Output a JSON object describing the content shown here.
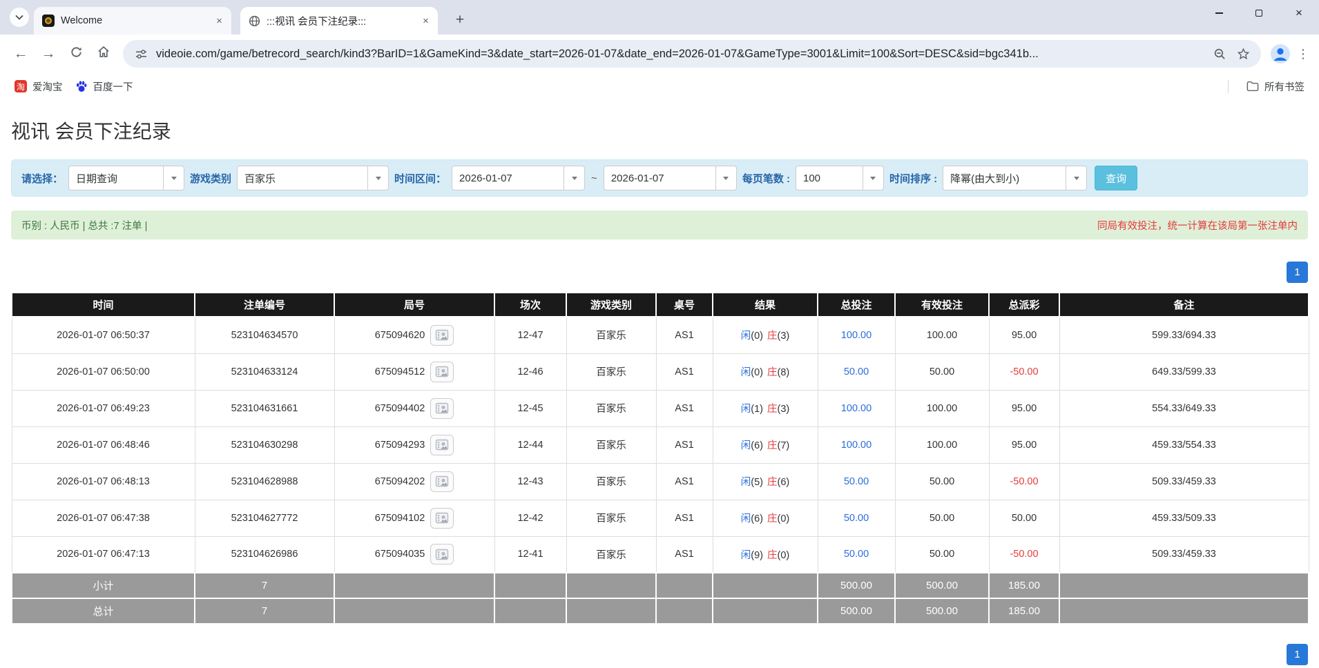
{
  "colors": {
    "pagination-blue": "#2878d8",
    "link-blue": "#2a6edb",
    "result-red": "#e43b3b",
    "filter-panel-blue": "#d9edf7",
    "summary-bar-green": "#dff0d8",
    "search-button-blue": "#5bc0de",
    "table-header-dark": "#1a1a1a"
  },
  "icons": {
    "close-icon": "×",
    "new-tab-icon": "+",
    "back-icon": "←",
    "forward-icon": "→",
    "menu-icon": "⋮",
    "taobao-icon": "淘",
    "minimize-icon": "–",
    "maximize-icon": "□",
    "reload-icon": "circular-arrow",
    "home-icon": "house",
    "tune-icon": "sliders",
    "zoom-icon": "magnifier-minus",
    "bookmark-star-icon": "star-outline",
    "profile-avatar-icon": "person-circle",
    "globe-icon": "globe",
    "folder-icon": "folder",
    "baidu-icon": "paw",
    "video-replay-icon": "film-frame",
    "dropdown-caret-icon": "▾",
    "tab-search-icon": "chevron-down"
  },
  "browser": {
    "tabs": [
      {
        "title": "Welcome"
      },
      {
        "title": ":::视讯 会员下注纪录:::"
      }
    ],
    "url": "videoie.com/game/betrecord_search/kind3?BarID=1&GameKind=3&date_start=2026-01-07&date_end=2026-01-07&GameType=3001&Limit=100&Sort=DESC&sid=bgc341b...",
    "bookmarks": {
      "taobao": "爱淘宝",
      "baidu": "百度一下",
      "all_bookmarks": "所有书签"
    }
  },
  "page": {
    "title": "视讯 会员下注纪录",
    "filters": {
      "select_label": "请选择：",
      "select_value": "日期查询",
      "game_label": "游戏类别",
      "game_value": "百家乐",
      "range_label": "时间区间：",
      "date_start": "2026-01-07",
      "tilde": "~",
      "date_end": "2026-01-07",
      "per_page_label": "每页笔数 :",
      "per_page_value": "100",
      "sort_label": "时间排序 :",
      "sort_value": "降幂(由大到小)",
      "search_button": "查询"
    },
    "summary_bar": {
      "left": "币别 : 人民币 | 总共 :7 注单 |",
      "right": "同局有效投注，统一计算在该局第一张注单内"
    },
    "pagination": {
      "page": "1"
    },
    "table": {
      "headers": [
        "时间",
        "注单编号",
        "局号",
        "场次",
        "游戏类别",
        "桌号",
        "结果",
        "总投注",
        "有效投注",
        "总派彩",
        "备注"
      ],
      "rows": [
        {
          "time": "2026-01-07 06:50:37",
          "bet_id": "523104634570",
          "round_id": "675094620",
          "session": "12-47",
          "game": "百家乐",
          "table_no": "AS1",
          "pl": "闲",
          "pc": "(0)",
          "bl": "庄",
          "bc": "(3)",
          "total_bet": "100.00",
          "valid_bet": "100.00",
          "payout": "95.00",
          "note": "599.33/694.33"
        },
        {
          "time": "2026-01-07 06:50:00",
          "bet_id": "523104633124",
          "round_id": "675094512",
          "session": "12-46",
          "game": "百家乐",
          "table_no": "AS1",
          "pl": "闲",
          "pc": "(0)",
          "bl": "庄",
          "bc": "(8)",
          "total_bet": "50.00",
          "valid_bet": "50.00",
          "payout": "-50.00",
          "note": "649.33/599.33"
        },
        {
          "time": "2026-01-07 06:49:23",
          "bet_id": "523104631661",
          "round_id": "675094402",
          "session": "12-45",
          "game": "百家乐",
          "table_no": "AS1",
          "pl": "闲",
          "pc": "(1)",
          "bl": "庄",
          "bc": "(3)",
          "total_bet": "100.00",
          "valid_bet": "100.00",
          "payout": "95.00",
          "note": "554.33/649.33"
        },
        {
          "time": "2026-01-07 06:48:46",
          "bet_id": "523104630298",
          "round_id": "675094293",
          "session": "12-44",
          "game": "百家乐",
          "table_no": "AS1",
          "pl": "闲",
          "pc": "(6)",
          "bl": "庄",
          "bc": "(7)",
          "total_bet": "100.00",
          "valid_bet": "100.00",
          "payout": "95.00",
          "note": "459.33/554.33"
        },
        {
          "time": "2026-01-07 06:48:13",
          "bet_id": "523104628988",
          "round_id": "675094202",
          "session": "12-43",
          "game": "百家乐",
          "table_no": "AS1",
          "pl": "闲",
          "pc": "(5)",
          "bl": "庄",
          "bc": "(6)",
          "total_bet": "50.00",
          "valid_bet": "50.00",
          "payout": "-50.00",
          "note": "509.33/459.33"
        },
        {
          "time": "2026-01-07 06:47:38",
          "bet_id": "523104627772",
          "round_id": "675094102",
          "session": "12-42",
          "game": "百家乐",
          "table_no": "AS1",
          "pl": "闲",
          "pc": "(6)",
          "bl": "庄",
          "bc": "(0)",
          "total_bet": "50.00",
          "valid_bet": "50.00",
          "payout": "50.00",
          "note": "459.33/509.33"
        },
        {
          "time": "2026-01-07 06:47:13",
          "bet_id": "523104626986",
          "round_id": "675094035",
          "session": "12-41",
          "game": "百家乐",
          "table_no": "AS1",
          "pl": "闲",
          "pc": "(9)",
          "bl": "庄",
          "bc": "(0)",
          "total_bet": "50.00",
          "valid_bet": "50.00",
          "payout": "-50.00",
          "note": "509.33/459.33"
        }
      ],
      "subtotal": {
        "label": "小计",
        "count": "7",
        "total_bet": "500.00",
        "valid_bet": "500.00",
        "payout": "185.00"
      },
      "total": {
        "label": "总计",
        "count": "7",
        "total_bet": "500.00",
        "valid_bet": "500.00",
        "payout": "185.00"
      }
    }
  }
}
